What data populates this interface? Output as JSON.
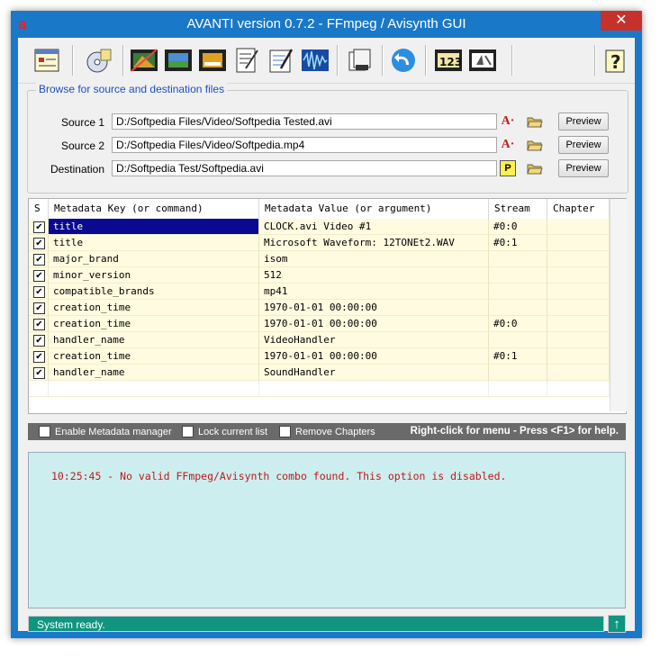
{
  "window": {
    "app_icon_letter": "a",
    "title": "AVANTI  version  0.7.2  -  FFmpeg / Avisynth GUI",
    "close_glyph": "✕"
  },
  "toolbar": {
    "buttons": [
      {
        "name": "settings-window-icon"
      },
      {
        "name": "disc-settings-icon"
      },
      {
        "name": "video-filter-icon"
      },
      {
        "name": "film-strip-icon"
      },
      {
        "name": "subtitle-film-icon"
      },
      {
        "name": "text-edit-icon"
      },
      {
        "name": "document-edit-icon"
      },
      {
        "name": "audio-waveform-icon"
      },
      {
        "name": "batch-copy-icon"
      },
      {
        "name": "undo-arrow-icon"
      },
      {
        "name": "numbers-film-icon"
      },
      {
        "name": "script-film-icon"
      },
      {
        "name": "help-icon"
      }
    ],
    "help_glyph": "?"
  },
  "files": {
    "legend": "Browse for source and destination files",
    "source1": {
      "label": "Source 1",
      "value": "D:/Softpedia Files/Video/Softpedia Tested.avi",
      "preview": "Preview"
    },
    "source2": {
      "label": "Source 2",
      "value": "D:/Softpedia Files/Video/Softpedia.mp4",
      "preview": "Preview"
    },
    "destination": {
      "label": "Destination",
      "value": "D:/Softpedia Test/Softpedia.avi",
      "preview": "Preview",
      "p_button": "P"
    },
    "avisynth_glyph": "A·"
  },
  "metadata_table": {
    "headers": [
      "S",
      "Metadata Key (or command)",
      "Metadata Value (or argument)",
      "Stream",
      "Chapter"
    ],
    "rows": [
      {
        "checked": true,
        "key": "title",
        "value": "CLOCK.avi Video #1",
        "stream": "#0:0",
        "chapter": "",
        "selected": true
      },
      {
        "checked": true,
        "key": "title",
        "value": "Microsoft Waveform: 12TONEt2.WAV",
        "stream": "#0:1",
        "chapter": ""
      },
      {
        "checked": true,
        "key": "major_brand",
        "value": "isom",
        "stream": "",
        "chapter": ""
      },
      {
        "checked": true,
        "key": "minor_version",
        "value": "512",
        "stream": "",
        "chapter": ""
      },
      {
        "checked": true,
        "key": "compatible_brands",
        "value": "mp41",
        "stream": "",
        "chapter": ""
      },
      {
        "checked": true,
        "key": "creation_time",
        "value": "1970-01-01 00:00:00",
        "stream": "",
        "chapter": ""
      },
      {
        "checked": true,
        "key": "creation_time",
        "value": "1970-01-01 00:00:00",
        "stream": "#0:0",
        "chapter": ""
      },
      {
        "checked": true,
        "key": "handler_name",
        "value": "VideoHandler",
        "stream": "",
        "chapter": ""
      },
      {
        "checked": true,
        "key": "creation_time",
        "value": "1970-01-01 00:00:00",
        "stream": "#0:1",
        "chapter": ""
      },
      {
        "checked": true,
        "key": "handler_name",
        "value": "SoundHandler",
        "stream": "",
        "chapter": ""
      }
    ],
    "check_glyph": "✔"
  },
  "options": {
    "enable_metadata": "Enable Metadata manager",
    "lock_list": "Lock current list",
    "remove_chapters": "Remove Chapters",
    "hint": "Right-click for menu  -  Press <F1> for help."
  },
  "log": {
    "message": "10:25:45 - No valid FFmpeg/Avisynth combo found. This option is disabled."
  },
  "status": {
    "text": "System ready.",
    "arrow_glyph": "↑"
  },
  "colors": {
    "title_bar": "#1a78c8",
    "close_button": "#c7312b",
    "row_fill": "#fffbe0",
    "selected_row": "#0a0a90",
    "log_background": "#cdeeee",
    "log_text": "#c0181b",
    "status_bar": "#0f9580",
    "options_bar": "#6a6a6a",
    "legend_text": "#1f4fbf"
  }
}
